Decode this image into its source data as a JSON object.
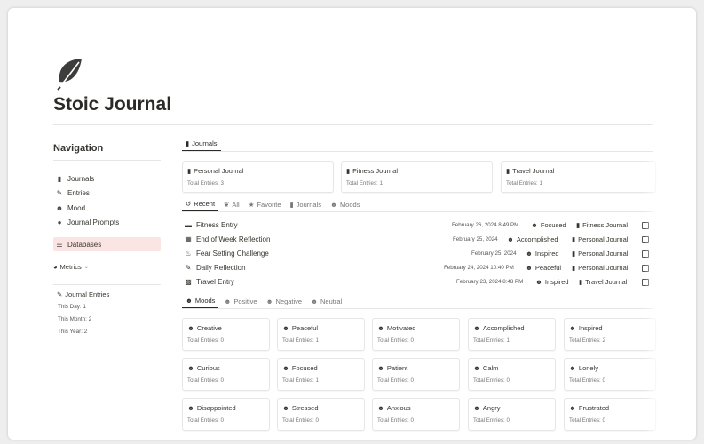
{
  "page": {
    "title": "Stoic Journal",
    "icon": "leaf-icon"
  },
  "navigation": {
    "heading": "Navigation",
    "items": [
      {
        "label": "Journals",
        "icon": "book-icon"
      },
      {
        "label": "Entries",
        "icon": "pen-icon"
      },
      {
        "label": "Mood",
        "icon": "smiley-icon"
      },
      {
        "label": "Journal Prompts",
        "icon": "lightbulb-icon"
      }
    ],
    "databases": {
      "label": "Databases",
      "icon": "database-icon"
    }
  },
  "metrics": {
    "heading": "Metrics",
    "title": "Journal Entries",
    "lines": [
      "This Day: 1",
      "This Month: 2",
      "This Year: 2"
    ]
  },
  "journals_tab": {
    "label": "Journals"
  },
  "journals": [
    {
      "name": "Personal Journal",
      "entries": "Total Entries: 3"
    },
    {
      "name": "Fitness Journal",
      "entries": "Total Entries: 1"
    },
    {
      "name": "Travel Journal",
      "entries": "Total Entries: 1"
    }
  ],
  "entry_tabs": [
    {
      "label": "Recent",
      "icon": "history-icon"
    },
    {
      "label": "All",
      "icon": "leaf-icon"
    },
    {
      "label": "Favorite",
      "icon": "star-icon"
    },
    {
      "label": "Journals",
      "icon": "book-icon"
    },
    {
      "label": "Moods",
      "icon": "smiley-icon"
    }
  ],
  "entries": [
    {
      "title": "Fitness Entry",
      "icon": "dumbbell-icon",
      "date": "February 26, 2024 8:49 PM",
      "mood": "Focused",
      "journal": "Fitness Journal"
    },
    {
      "title": "End of Week Reflection",
      "icon": "calendar-icon",
      "date": "February 25, 2024",
      "mood": "Accomplished",
      "journal": "Personal Journal"
    },
    {
      "title": "Fear Setting Challenge",
      "icon": "flame-icon",
      "date": "February 25, 2024",
      "mood": "Inspired",
      "journal": "Personal Journal"
    },
    {
      "title": "Daily Reflection",
      "icon": "pen-icon",
      "date": "February 24, 2024 10:40 PM",
      "mood": "Peaceful",
      "journal": "Personal Journal"
    },
    {
      "title": "Travel Entry",
      "icon": "map-icon",
      "date": "February 23, 2024 8:48 PM",
      "mood": "Inspired",
      "journal": "Travel Journal"
    }
  ],
  "mood_tabs": [
    {
      "label": "Moods"
    },
    {
      "label": "Positive"
    },
    {
      "label": "Negative"
    },
    {
      "label": "Neutral"
    }
  ],
  "moods": [
    {
      "name": "Creative",
      "entries": "Total Entries: 0"
    },
    {
      "name": "Peaceful",
      "entries": "Total Entries: 1"
    },
    {
      "name": "Motivated",
      "entries": "Total Entries: 0"
    },
    {
      "name": "Accomplished",
      "entries": "Total Entries: 1"
    },
    {
      "name": "Inspired",
      "entries": "Total Entries: 2"
    },
    {
      "name": "Curious",
      "entries": "Total Entries: 0"
    },
    {
      "name": "Focused",
      "entries": "Total Entries: 1"
    },
    {
      "name": "Patient",
      "entries": "Total Entries: 0"
    },
    {
      "name": "Calm",
      "entries": "Total Entries: 0"
    },
    {
      "name": "Lonely",
      "entries": "Total Entries: 0"
    },
    {
      "name": "Disappointed",
      "entries": "Total Entries: 0"
    },
    {
      "name": "Stressed",
      "entries": "Total Entries: 0"
    },
    {
      "name": "Anxious",
      "entries": "Total Entries: 0"
    },
    {
      "name": "Angry",
      "entries": "Total Entries: 0"
    },
    {
      "name": "Frustrated",
      "entries": "Total Entries: 0"
    }
  ],
  "colors": {
    "active_nav_bg": "#fbe4e4",
    "text": "#37352f",
    "border": "#e6e6e4"
  }
}
